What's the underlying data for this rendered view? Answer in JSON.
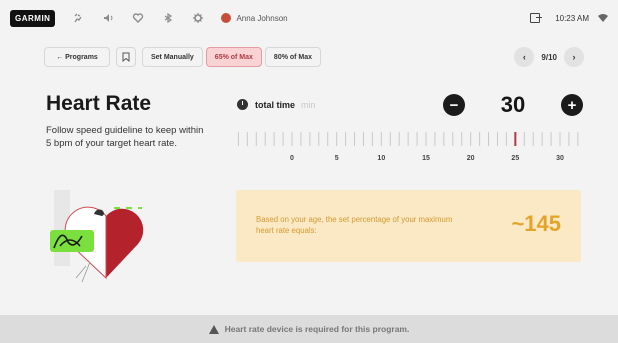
{
  "topbar": {
    "logo": "GARMIN",
    "icons": [
      "running-icon",
      "volume-icon",
      "heart-icon",
      "bluetooth-icon",
      "gear-icon"
    ],
    "user_name": "Anna Johnson",
    "time": "10:23 AM"
  },
  "toolbar": {
    "back_label": "← Programs",
    "modes": [
      "Set Manually",
      "65% of Max",
      "80% of Max"
    ],
    "active_mode": "65% of Max",
    "page_counter": "9/10"
  },
  "main": {
    "title": "Heart Rate",
    "description": "Follow speed guideline to keep within 5 bpm of your target heart rate."
  },
  "time": {
    "label": "total time",
    "unit": "min",
    "value": "30",
    "minus": "−",
    "plus": "+",
    "ruler_labels": [
      "0",
      "5",
      "10",
      "15",
      "20",
      "25",
      "30"
    ],
    "ruler_marker": 25
  },
  "info": {
    "text": "Based on your age, the set percentage of your maximum heart rate equals:",
    "value": "~145"
  },
  "footer": {
    "text": "Heart rate device is required for this program."
  },
  "colors": {
    "accent": "#b13a45",
    "active_bg": "#f9d2d3",
    "info_bg": "#fbe9c6",
    "info_text": "#d39a2f",
    "info_value": "#e3a529",
    "heart": "#b4222c",
    "lime": "#7be03d"
  }
}
